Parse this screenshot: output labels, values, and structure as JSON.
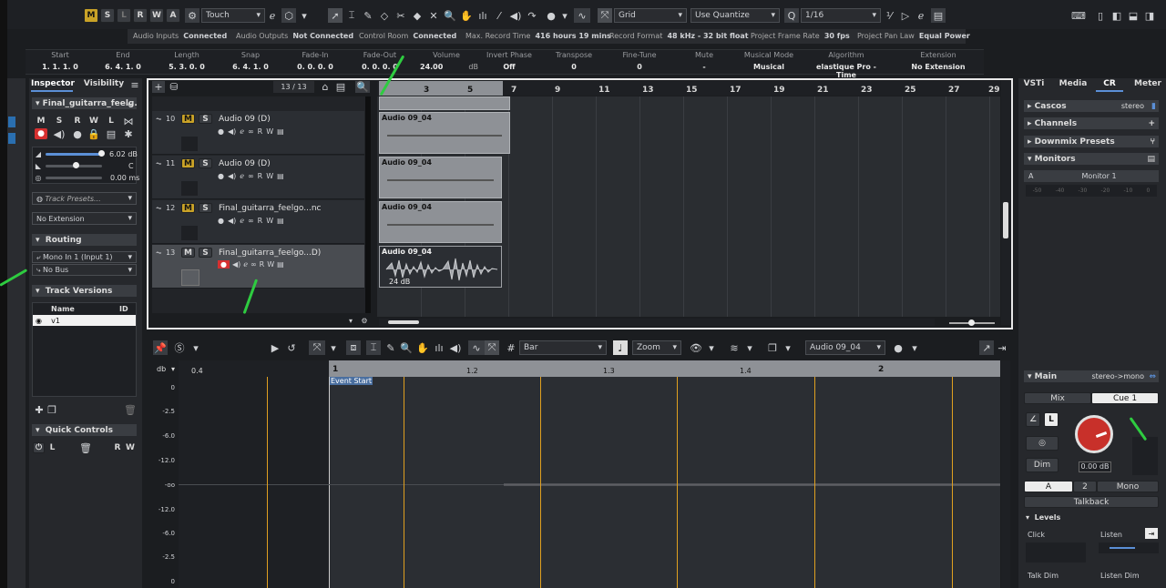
{
  "toolbar": {
    "automation_mode": "Touch",
    "snap_type": "Grid",
    "quantize_mode": "Use Quantize",
    "quantize_value": "1/16",
    "state_buttons": [
      "M",
      "S",
      "L",
      "R",
      "W",
      "A"
    ]
  },
  "status_bar": [
    {
      "label": "Audio Inputs",
      "value": "Connected"
    },
    {
      "label": "Audio Outputs",
      "value": "Not Connected"
    },
    {
      "label": "Control Room",
      "value": "Connected"
    },
    {
      "label": "Max. Record Time",
      "value": "416 hours 19 mins"
    },
    {
      "label": "Record Format",
      "value": "48 kHz - 32 bit float"
    },
    {
      "label": "Project Frame Rate",
      "value": "30 fps"
    },
    {
      "label": "Project Pan Law",
      "value": "Equal Power"
    }
  ],
  "info_line": [
    {
      "label": "Start",
      "value": "1. 1. 1.   0"
    },
    {
      "label": "End",
      "value": "6. 4. 1.   0"
    },
    {
      "label": "Length",
      "value": "5. 3. 0.   0"
    },
    {
      "label": "Snap",
      "value": "6. 4. 1.   0"
    },
    {
      "label": "Fade-In",
      "value": "0. 0. 0.   0"
    },
    {
      "label": "Fade-Out",
      "value": "0. 0. 0.   0"
    },
    {
      "label": "Volume",
      "value": "24.00"
    },
    {
      "label": "Invert Phase",
      "value": "Off"
    },
    {
      "label": "Transpose",
      "value": "0"
    },
    {
      "label": "Fine-Tune",
      "value": "0"
    },
    {
      "label": "Mute",
      "value": "-"
    },
    {
      "label": "Musical Mode",
      "value": "Musical"
    },
    {
      "label": "Algorithm",
      "value": "elastique Pro - Time"
    },
    {
      "label": "Extension",
      "value": "No Extension"
    }
  ],
  "volume_unit": "dB",
  "inspector": {
    "tabs": [
      "Inspector",
      "Visibility"
    ],
    "track_name": "Final_guitarra_feelg.",
    "volume": "6.02 dB",
    "pan": "C",
    "delay": "0.00 ms",
    "track_presets_placeholder": "Track Presets...",
    "extension": "No Extension",
    "routing_title": "Routing",
    "input": "Mono In 1 (Input 1)",
    "output": "No Bus",
    "versions_title": "Track Versions",
    "versions_cols": [
      "Name",
      "ID"
    ],
    "version_row": "v1",
    "quick_controls_title": "Quick Controls"
  },
  "project": {
    "track_count": "13 / 13",
    "tracks": [
      {
        "num": "10",
        "name": "Audio 09 (D)",
        "clip": "Audio 09_04"
      },
      {
        "num": "11",
        "name": "Audio 09 (D)",
        "clip": "Audio 09_04"
      },
      {
        "num": "12",
        "name": "Final_guitarra_feelgo...nc",
        "clip": "Audio 09_04"
      },
      {
        "num": "13",
        "name": "Final_guitarra_feelgo...D)",
        "clip": "Audio 09_04",
        "clip_gain": "24 dB"
      }
    ],
    "ruler": [
      "3",
      "5",
      "7",
      "9",
      "11",
      "13",
      "15",
      "17",
      "19",
      "21",
      "23",
      "25",
      "27",
      "29"
    ]
  },
  "editor": {
    "ruler_unit": "Bar",
    "zoom": "Zoom",
    "clip_name": "Audio 09_04",
    "db_label": "db",
    "db_scale": [
      "0",
      "-2.5",
      "-6.0",
      "-12.0",
      "-oo",
      "-12.0",
      "-6.0",
      "-2.5",
      "0"
    ],
    "ruler": [
      "0.4",
      "1",
      "1.2",
      "1.3",
      "1.4",
      "2"
    ],
    "event_start": "Event Start"
  },
  "right_zone": {
    "tabs": [
      "VSTi",
      "Media",
      "CR",
      "Meter"
    ],
    "sections": [
      "Cascos",
      "Channels",
      "Downmix Presets",
      "Monitors"
    ],
    "cascos_value": "stereo",
    "monitor": "Monitor 1",
    "monitor_a": "A",
    "meter_scale": [
      "-50",
      "-40",
      "-30",
      "-20",
      "-10",
      "0"
    ],
    "main_title": "Main",
    "main_value": "stereo->mono",
    "mix": "Mix",
    "cue": "Cue 1",
    "l_button": "L",
    "dim": "Dim",
    "level": "0.00 dB",
    "bus_a": "A",
    "bus_2": "2",
    "bus_mono": "Mono",
    "talkback": "Talkback",
    "levels_title": "Levels",
    "click": "Click",
    "listen": "Listen",
    "talk_dim": "Talk Dim",
    "listen_dim": "Listen Dim"
  }
}
